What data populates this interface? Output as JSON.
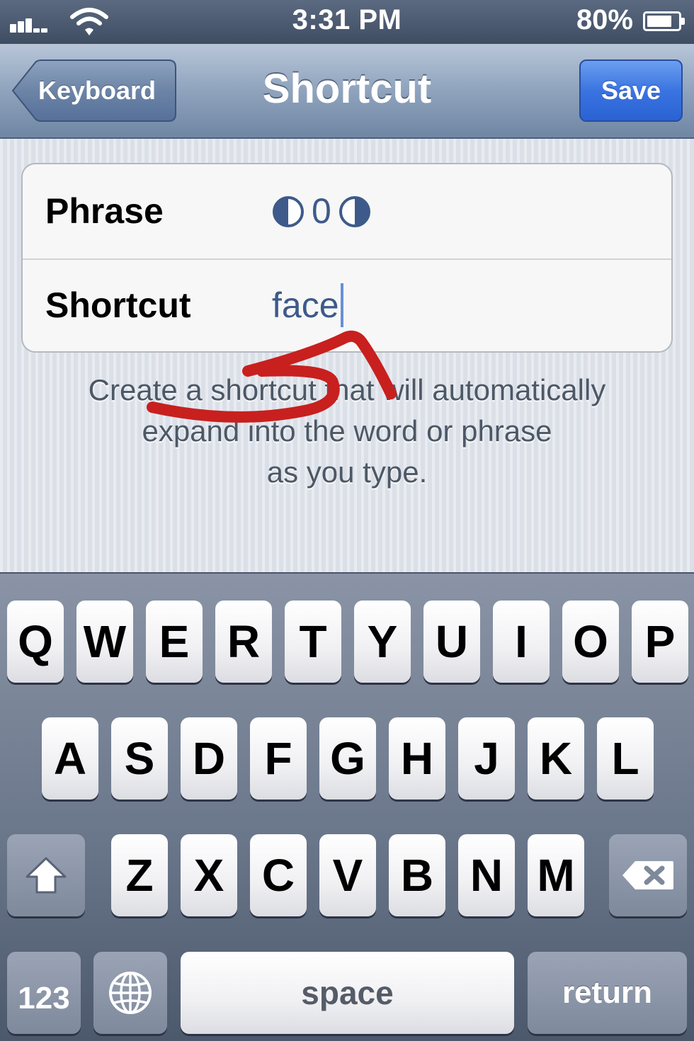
{
  "status_bar": {
    "time": "3:31 PM",
    "battery_percent": "80%",
    "battery_level": 0.8,
    "icons": [
      "signal-icon",
      "wifi-icon",
      "battery-icon"
    ]
  },
  "nav": {
    "back_label": "Keyboard",
    "title": "Shortcut",
    "save_label": "Save",
    "save_color": "#3a74e0"
  },
  "form": {
    "phrase_label": "Phrase",
    "phrase_value": "0",
    "phrase_icons": [
      "half-circle-left-icon",
      "half-circle-right-icon"
    ],
    "shortcut_label": "Shortcut",
    "shortcut_value": "face"
  },
  "helper": {
    "line1": "Create a shortcut that will automatically",
    "line2": "expand into the word or phrase",
    "line3": "as you type."
  },
  "keyboard": {
    "row1": [
      "Q",
      "W",
      "E",
      "R",
      "T",
      "Y",
      "U",
      "I",
      "O",
      "P"
    ],
    "row2": [
      "A",
      "S",
      "D",
      "F",
      "G",
      "H",
      "J",
      "K",
      "L"
    ],
    "row3": [
      "Z",
      "X",
      "C",
      "V",
      "B",
      "N",
      "M"
    ],
    "numbers_label": "123",
    "space_label": "space",
    "return_label": "return",
    "icons": [
      "shift-icon",
      "delete-icon",
      "globe-icon"
    ]
  },
  "annotation_color": "#c8201e"
}
